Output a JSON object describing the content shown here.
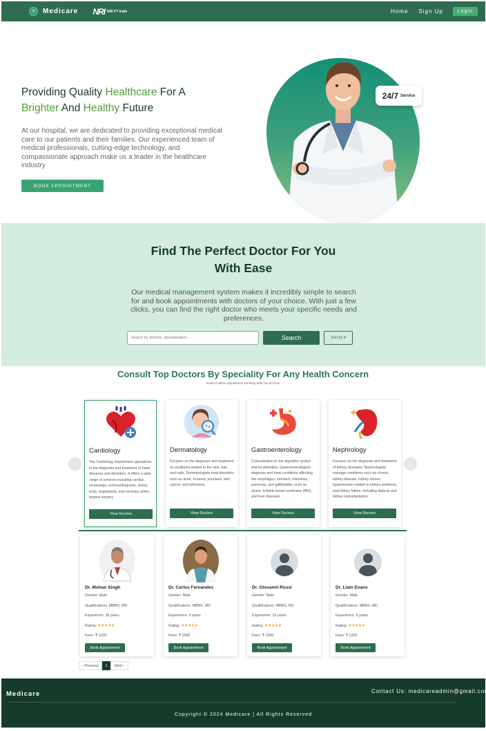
{
  "nav": {
    "brand": "Medicare",
    "partner_logo": "NRI",
    "partner_text": "NRI FT India",
    "links": [
      "Home",
      "Sign Up"
    ],
    "login": "Login"
  },
  "hero": {
    "title_parts": [
      "Providing Quality ",
      "Healthcare",
      " For A ",
      "Brighter",
      " And ",
      "Healthy",
      " Future"
    ],
    "description": "At our hospital, we are dedicated to providing exceptional medical care to our patients and their families. Our experienced team of medical professionals, cutting-edge technology, and compassionate approach make us a leader in the healthcare industry",
    "button": "BOOK APPOINTMENT",
    "badge_number": "24/7",
    "badge_text": "Service"
  },
  "find": {
    "title": "Find The Perfect Doctor For You With Ease",
    "description": "Our medical management system makes it incredibly simple to search for and book appointments with doctors of your choice. With just a few clicks, you can find the right doctor who meets your specific needs and preferences.",
    "search_placeholder": "Search by doctors, specialization.....",
    "search_button": "Search",
    "sort_button": "Sort by ▾"
  },
  "specialities": {
    "title": "Consult Top Doctors By Speciality For Any Health Concern",
    "subtitle": "Instant Online Appointment Booking With Top Doctors",
    "prev_arrow": "‹",
    "next_arrow": "›",
    "items": [
      {
        "name": "Cardiology",
        "icon": "heart-icon",
        "description": "The Cardiology Department specializes in the diagnosis and treatment of heart diseases and disorders. It offers a wide range of services including cardiac screenings, echocardiograms, stress tests, angioplasty, and coronary artery bypass surgery.",
        "button": "View Doctors"
      },
      {
        "name": "Dermatology",
        "icon": "skin-magnifier-icon",
        "description": "Focuses on the diagnosis and treatment of conditions related to the skin, hair, and nails. Dermatologists treat disorders such as acne, eczema, psoriasis, skin cancer, and infections.",
        "button": "View Doctors"
      },
      {
        "name": "Gastroenterology",
        "icon": "stomach-icon",
        "description": "Concentrates on the digestive system and its disorders. Gastroenterologists diagnose and treat conditions affecting the esophagus, stomach, intestines, pancreas, and gallbladder, such as ulcers, irritable bowel syndrome (IBS), and liver diseases.",
        "button": "View Doctors"
      },
      {
        "name": "Nephrology",
        "icon": "kidney-icon",
        "description": "Focuses on the diagnosis and treatment of kidney diseases. Nephrologists manage conditions such as chronic kidney disease, kidney stones, hypertension related to kidney problems, and kidney failure, including dialysis and kidney transplantation.",
        "button": "View Doctors"
      }
    ]
  },
  "doctors": [
    {
      "name": "Dr. Mohan Singh",
      "gender": "Gender: Male",
      "qualifications": "Qualifications: MBBS, DM",
      "experience": "Experience: 18 years",
      "rating_label": "Rating:",
      "rating": 5,
      "fees": "Fees: ₹ 1200",
      "button": "Book Appointment",
      "avatar": "photo"
    },
    {
      "name": "Dr. Carlos Fernandez",
      "gender": "Gender: Male",
      "qualifications": "Qualifications: MBBS, MD",
      "experience": "Experience: 9 years",
      "rating_label": "Rating:",
      "rating": 5,
      "fees": "Fees: ₹ 1500",
      "button": "Book Appointment",
      "avatar": "photo"
    },
    {
      "name": "Dr. Giovanni Rossi",
      "gender": "Gender: Male",
      "qualifications": "Qualifications: MBBS, MS",
      "experience": "Experience: 13 years",
      "rating_label": "Rating:",
      "rating": 5,
      "fees": "Fees: ₹ 1000",
      "button": "Book Appointment",
      "avatar": "placeholder"
    },
    {
      "name": "Dr. Liam Evans",
      "gender": "Gender: Male",
      "qualifications": "Qualifications: MBBS, MD",
      "experience": "Experience: 5 years",
      "rating_label": "Rating:",
      "rating": 5,
      "fees": "Fees: ₹ 1200",
      "button": "Book Appointment",
      "avatar": "placeholder"
    }
  ],
  "pagination": {
    "previous": "‹ Previous",
    "current": "1",
    "next": "Next ›"
  },
  "footer": {
    "brand": "Medicare",
    "contact": "Contact Us: medicareadmin@gmail.com",
    "copyright": "Copyright © 2024 Medicare | All Rights Reserved"
  },
  "colors": {
    "primary": "#2e6d4f",
    "accent": "#3aa374",
    "light_bg": "#d3ecdf",
    "footer": "#163a2a",
    "title_teal": "#2b7263"
  }
}
